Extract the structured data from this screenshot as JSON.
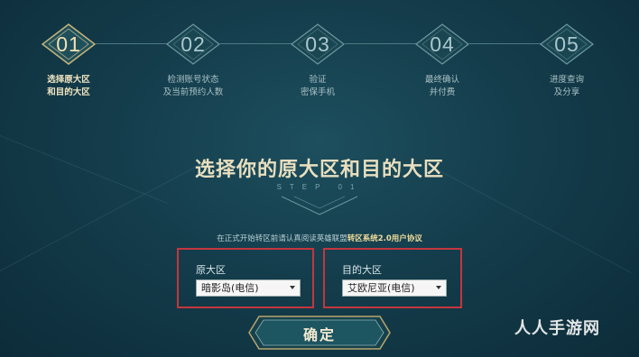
{
  "steps": [
    {
      "num": "01",
      "label": "选择原大区\n和目的大区",
      "active": true
    },
    {
      "num": "02",
      "label": "检测账号状态\n及当前预约人数",
      "active": false
    },
    {
      "num": "03",
      "label": "验证\n密保手机",
      "active": false
    },
    {
      "num": "04",
      "label": "最终确认\n并付费",
      "active": false
    },
    {
      "num": "05",
      "label": "进度查询\n及分享",
      "active": false
    }
  ],
  "title": "选择你的原大区和目的大区",
  "subtitle": "STEP 01",
  "notice": {
    "prefix": "在正式开始转区前请认真阅读英雄联盟",
    "link": "转区系统2.0用户协议"
  },
  "source": {
    "label": "原大区",
    "selected": "暗影岛(电信)"
  },
  "target": {
    "label": "目的大区",
    "selected": "艾欧尼亚(电信)"
  },
  "confirm_label": "确定",
  "watermark": "人人手游网",
  "colors": {
    "accent": "#c4363d",
    "gold": "#e9dfbf",
    "background": "#143d4c"
  }
}
